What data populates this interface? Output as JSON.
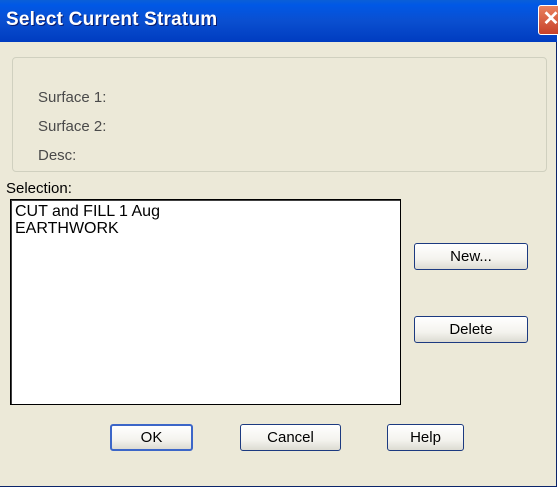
{
  "window": {
    "title": "Select Current Stratum",
    "close_glyph": "✕"
  },
  "info": {
    "surface1_label": "Surface 1:",
    "surface2_label": "Surface 2:",
    "desc_label": "Desc:"
  },
  "selection": {
    "label": "Selection:",
    "items": [
      "CUT and FILL 1 Aug",
      "EARTHWORK"
    ]
  },
  "buttons": {
    "new": "New...",
    "delete": "Delete",
    "ok": "OK",
    "cancel": "Cancel",
    "help": "Help"
  },
  "icons": {
    "close": "close-icon"
  },
  "colors": {
    "title_bar": "#0054e3",
    "close_button": "#d9553a",
    "dialog_face": "#ece9d8"
  }
}
